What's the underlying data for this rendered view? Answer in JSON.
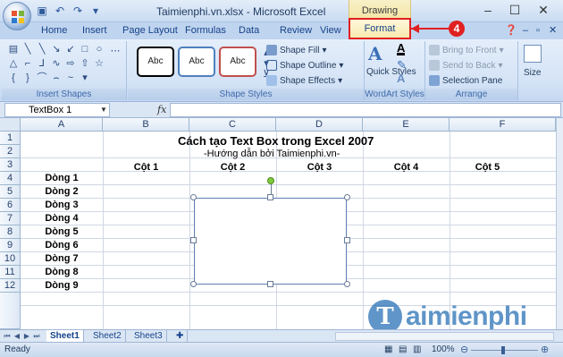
{
  "window": {
    "title": "Taimienphi.vn.xlsx - Microsoft Excel",
    "context_tab_title": "Drawing Tools",
    "minimize": "–",
    "maximize": "☐",
    "close": "✕"
  },
  "tabs": [
    "Home",
    "Insert",
    "Page Layout",
    "Formulas",
    "Data",
    "Review",
    "View"
  ],
  "active_tab": "Format",
  "callout": {
    "number": "4",
    "color": "#e02020"
  },
  "ribbon": {
    "groups": {
      "insert_shapes": "Insert Shapes",
      "shape_styles": "Shape Styles",
      "wordart_styles": "WordArt Styles",
      "arrange": "Arrange"
    },
    "style_presets": [
      "Abc",
      "Abc",
      "Abc"
    ],
    "style_colors": [
      "#000000",
      "#4f81bd",
      "#c0504d"
    ],
    "shape_fill": "Shape Fill",
    "shape_outline": "Shape Outline",
    "shape_effects": "Shape Effects",
    "quick_styles": "Quick Styles",
    "bring_to_front": "Bring to Front",
    "send_to_back": "Send to Back",
    "selection_pane": "Selection Pane",
    "size": "Size"
  },
  "formula_bar": {
    "name_box": "TextBox 1",
    "fx": "fx"
  },
  "grid": {
    "columns": [
      "A",
      "B",
      "C",
      "D",
      "E",
      "F"
    ],
    "rows": [
      "1",
      "2",
      "3",
      "4",
      "5",
      "6",
      "7",
      "8",
      "9",
      "10",
      "11",
      "12"
    ],
    "title": "Cách tạo Text Box trong Excel 2007",
    "subtitle": "-Hướng dẫn bởi Taimienphi.vn-",
    "col_headers": [
      "Cột 1",
      "Cột 2",
      "Cột 3",
      "Cột 4",
      "Cột 5"
    ],
    "row_labels": [
      "Dòng 1",
      "Dòng 2",
      "Dòng 3",
      "Dòng 4",
      "Dòng 5",
      "Dòng 6",
      "Dòng 7",
      "Dòng 8",
      "Dòng 9"
    ]
  },
  "sheets": [
    "Sheet1",
    "Sheet2",
    "Sheet3"
  ],
  "active_sheet": "Sheet1",
  "status": {
    "text": "Ready",
    "zoom": "100%",
    "zoom_value": 100
  },
  "watermark": {
    "logo_letter": "T",
    "text": "aimienphi"
  }
}
